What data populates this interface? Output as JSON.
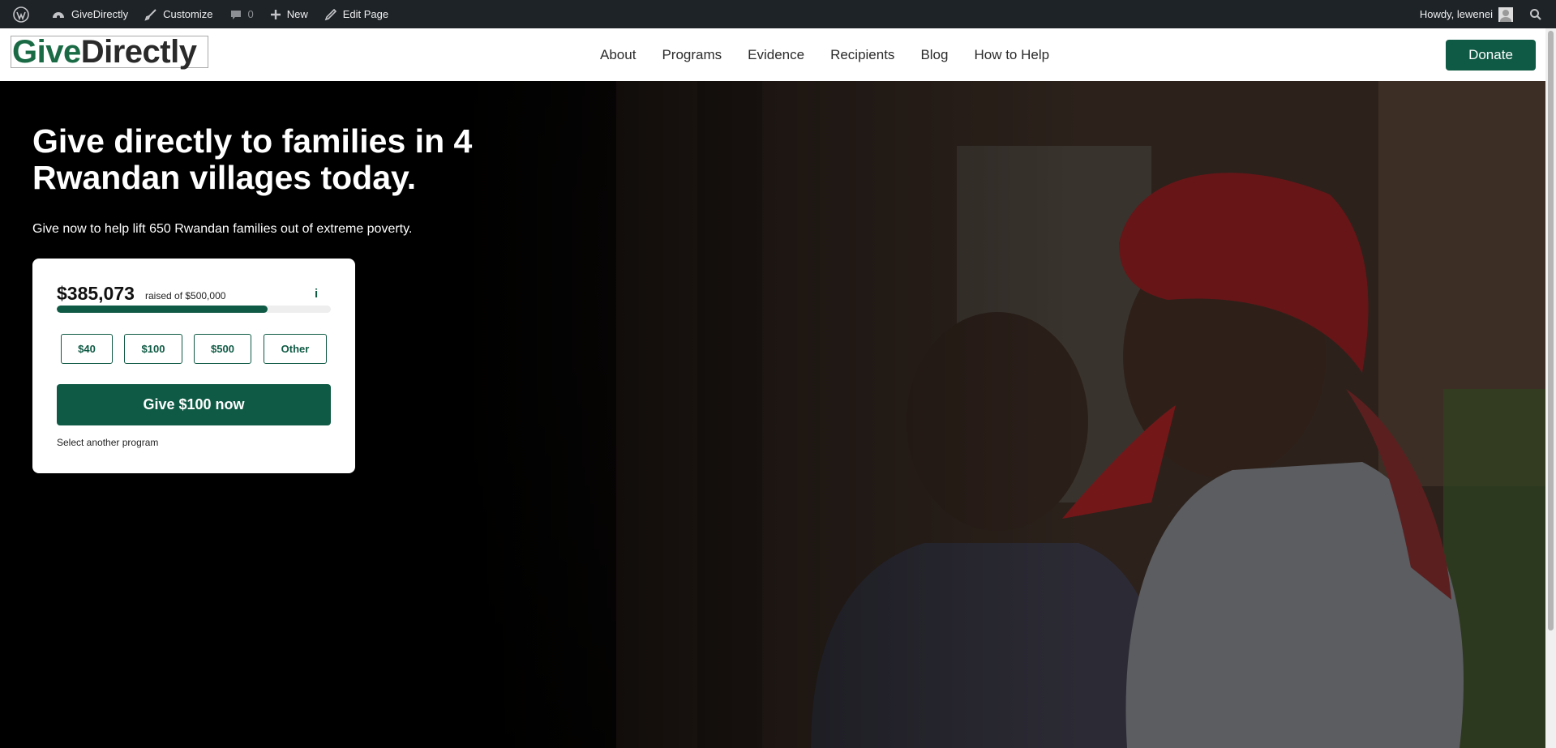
{
  "admin_bar": {
    "site_name": "GiveDirectly",
    "customize": "Customize",
    "comments_count": "0",
    "new": "New",
    "edit_page": "Edit Page",
    "howdy": "Howdy, lewenei"
  },
  "header": {
    "logo_give": "Give",
    "logo_directly": "Directly",
    "nav": [
      "About",
      "Programs",
      "Evidence",
      "Recipients",
      "Blog",
      "How to Help"
    ],
    "donate": "Donate"
  },
  "hero": {
    "title": "Give directly to families in 4 Rwandan villages today.",
    "subtitle": "Give now to help lift 650 Rwandan families out of extreme poverty.",
    "card": {
      "amount_raised": "$385,073",
      "raised_of": "raised of $500,000",
      "info_label": "i",
      "progress_fraction": 0.77,
      "amounts": [
        "$40",
        "$100",
        "$500",
        "Other"
      ],
      "give_button": "Give $100 now",
      "select_program": "Select another program"
    }
  },
  "colors": {
    "brand_green": "#0f5a44",
    "admin_bar_bg": "#1d2327"
  }
}
